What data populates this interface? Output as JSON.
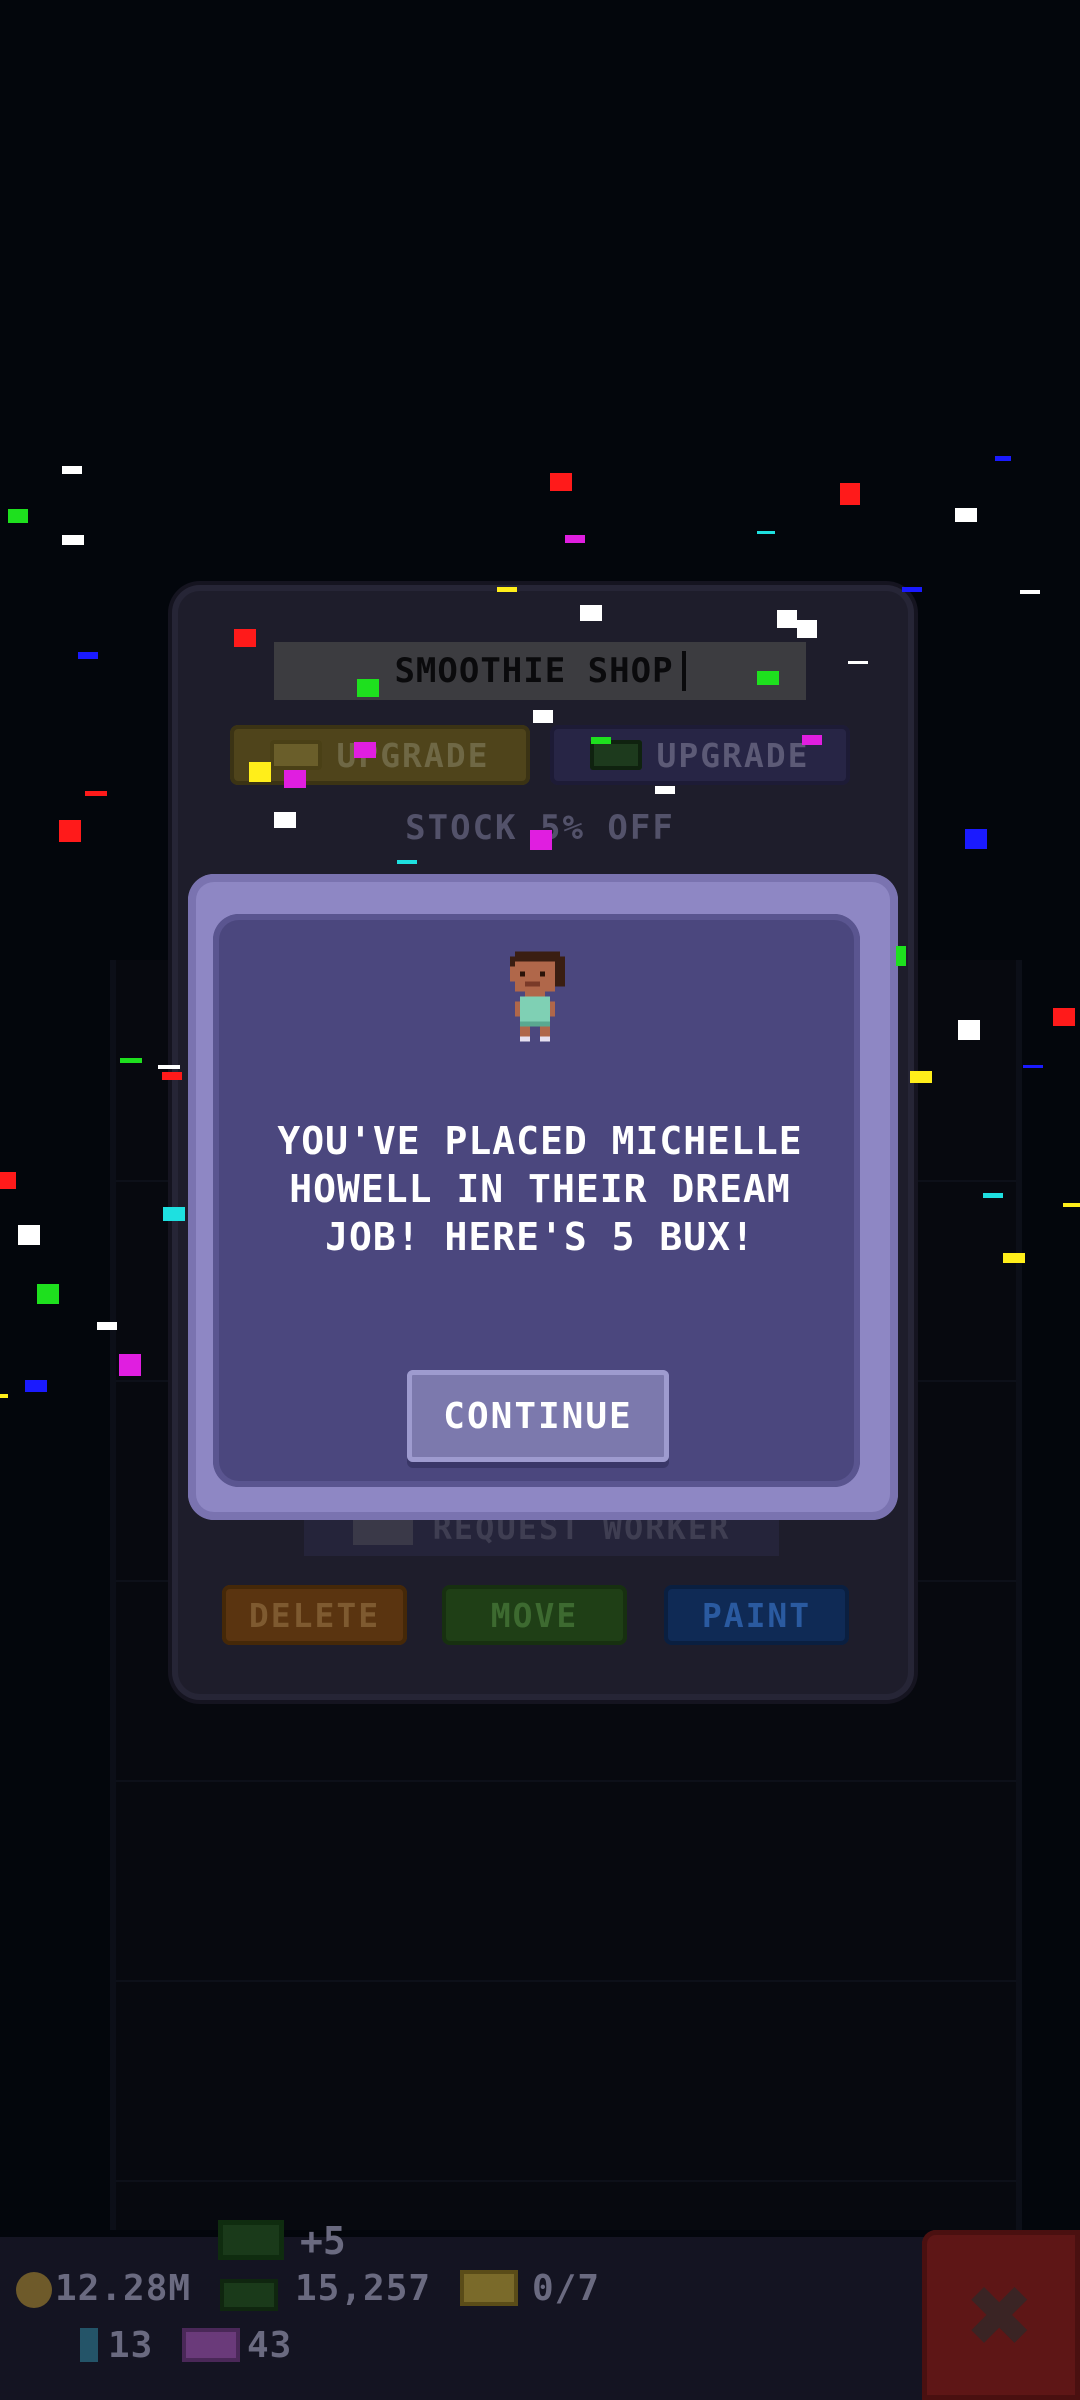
{
  "shop_panel": {
    "title": "SMOOTHIE SHOP",
    "upgrade_gold_label": "UPGRADE",
    "upgrade_cash_label": "UPGRADE",
    "stock_text": "STOCK 5% OFF",
    "request_worker_label": "REQUEST WORKER",
    "delete_label": "DELETE",
    "move_label": "MOVE",
    "paint_label": "PAINT"
  },
  "dialog": {
    "message": "YOU'VE PLACED MICHELLE HOWELL IN THEIR DREAM JOB! HERE'S 5 BUX!",
    "continue_label": "CONTINUE",
    "avatar_icon": "worker-avatar-icon"
  },
  "status_bar": {
    "coins": "12.28M",
    "bux": "15,257",
    "tickets": "0/7",
    "gems": "13",
    "tower_bux": "43",
    "bux_gain": "+5"
  },
  "colors": {
    "dialog_outer": "#8e87c4",
    "dialog_inner": "#4b477e",
    "continue_button": "#7c79ad",
    "background": "#03060c"
  }
}
